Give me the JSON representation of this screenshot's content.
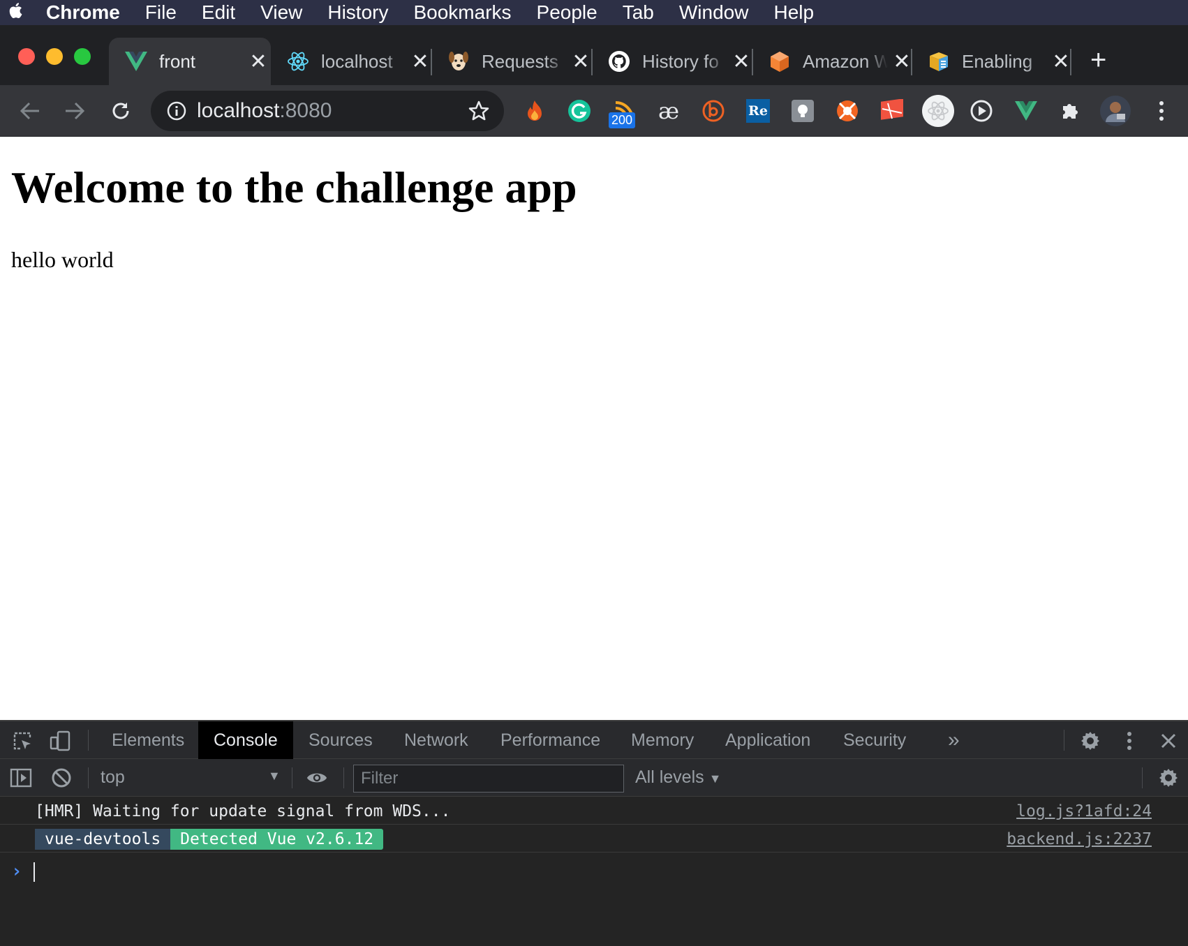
{
  "menubar": {
    "app": "Chrome",
    "items": [
      "File",
      "Edit",
      "View",
      "History",
      "Bookmarks",
      "People",
      "Tab",
      "Window",
      "Help"
    ]
  },
  "tabs": [
    {
      "label": "front",
      "icon": "vue-icon",
      "active": true
    },
    {
      "label": "localhost",
      "icon": "react-icon",
      "active": false
    },
    {
      "label": "Requests",
      "icon": "dog-icon",
      "active": false
    },
    {
      "label": "History fo",
      "icon": "github-icon",
      "active": false
    },
    {
      "label": "Amazon W",
      "icon": "amazon-box-icon",
      "active": false
    },
    {
      "label": "Enabling",
      "icon": "package-icon",
      "active": false
    }
  ],
  "omnibox": {
    "host": "localhost",
    "port": ":8080"
  },
  "extensions": {
    "rss_badge": "200",
    "ae_label": "æ",
    "re_label": "Re"
  },
  "page": {
    "heading": "Welcome to the challenge app",
    "text": "hello world"
  },
  "devtools": {
    "tabs": [
      "Elements",
      "Console",
      "Sources",
      "Network",
      "Performance",
      "Memory",
      "Application",
      "Security"
    ],
    "active_tab": "Console",
    "more": "»",
    "context": "top",
    "filter_placeholder": "Filter",
    "levels": "All levels",
    "console": [
      {
        "message": "[HMR] Waiting for update signal from WDS...",
        "source": "log.js?1afd:24"
      },
      {
        "badge1": "vue-devtools",
        "badge2": "Detected Vue v2.6.12",
        "source": "backend.js:2237"
      }
    ]
  },
  "colors": {
    "menubar_bg": "#2d3046",
    "tabstrip_bg": "#202124",
    "toolbar_bg": "#35363a",
    "vue_green": "#41b883",
    "vue_navy": "#35495e",
    "prompt_blue": "#4f8ff7"
  }
}
